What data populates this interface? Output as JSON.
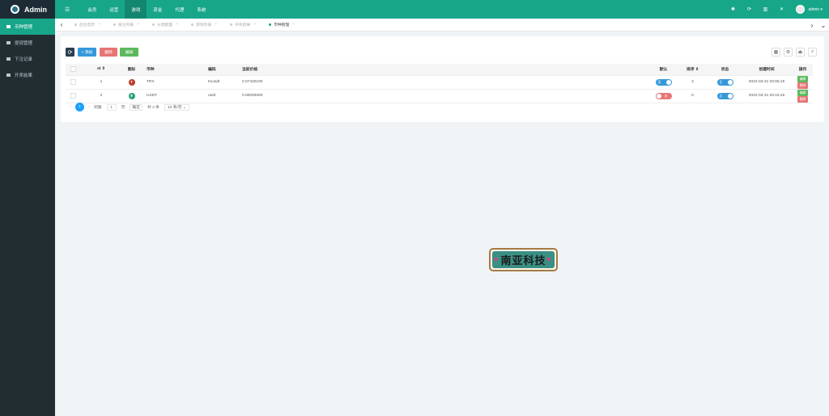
{
  "brand": {
    "title": "Admin"
  },
  "sidebar": {
    "items": [
      {
        "label": "币种管理",
        "active": true
      },
      {
        "label": "提现管理",
        "active": false
      },
      {
        "label": "下注记录",
        "active": false
      },
      {
        "label": "开奖结果",
        "active": false
      }
    ]
  },
  "topnav": {
    "menu_icon": "☰",
    "items": [
      {
        "label": "会员"
      },
      {
        "label": "运营"
      },
      {
        "label": "游戏"
      },
      {
        "label": "资金"
      },
      {
        "label": "代理"
      },
      {
        "label": "系统"
      }
    ],
    "active_index": 2,
    "right_icons": [
      "dashboard-icon",
      "refresh-icon",
      "trash-icon",
      "fullscreen-icon"
    ],
    "admin_name": "admin ▾"
  },
  "tabs": {
    "items": [
      {
        "label": "后台首页",
        "active": false
      },
      {
        "label": "投注列表",
        "active": false
      },
      {
        "label": "分类配置",
        "active": false
      },
      {
        "label": "游戏列表",
        "active": false
      },
      {
        "label": "开奖结果",
        "active": false
      },
      {
        "label": "币种管理",
        "active": true
      }
    ]
  },
  "toolbar": {
    "refresh_label": "⟳",
    "add_label": "+ 添加",
    "delete_label": "删除",
    "edit_label": "编辑"
  },
  "table": {
    "headers": [
      "",
      "Id ⇕",
      "图标",
      "币种",
      "编码",
      "当前价格",
      "默认",
      "排序 ⇕",
      "状态",
      "创建时间",
      "操作"
    ],
    "rows": [
      {
        "id": "1",
        "icon_color": "#c0392b",
        "icon_glyph": "T",
        "currency": "TRX",
        "code": "trxusdt",
        "price": "0.07420100",
        "default": "否",
        "default_on": true,
        "sort": "3",
        "status": "正",
        "time": "2022-03-31 03:06:15",
        "edit": "编辑",
        "delete": "删除"
      },
      {
        "id": "2",
        "icon_color": "#27a17a",
        "icon_glyph": "₮",
        "currency": "USDT",
        "code": "usdt",
        "price": "0.00000000",
        "default": "关",
        "default_on": false,
        "sort": "0",
        "status": "正",
        "time": "2022-03-31 03:15:46",
        "edit": "编辑",
        "delete": "删除"
      }
    ]
  },
  "pager": {
    "prev": "‹",
    "current": "1",
    "next": "›",
    "goto": "到第",
    "page_input": "1",
    "page_unit": "页",
    "confirm": "确定",
    "total": "共 2 条",
    "per_page": "10 条/页 ⌄"
  },
  "colors": {
    "primary": "#18a689",
    "sidebar": "#222d32",
    "blue": "#3498db",
    "red": "#e87474",
    "green": "#5cb85c"
  },
  "stamp": {
    "text": "南亚科技"
  }
}
